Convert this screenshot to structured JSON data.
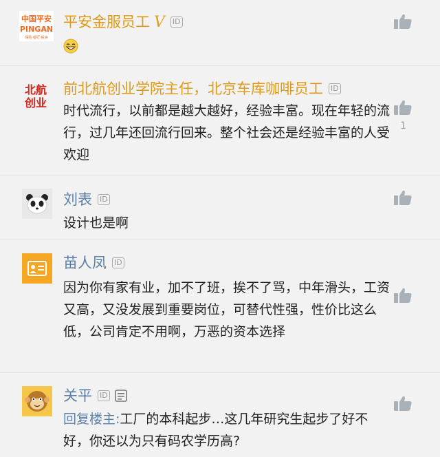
{
  "comments": [
    {
      "name": "平安金服员工",
      "name_color": "#e09a18",
      "verified": "V",
      "id_badge": "ID",
      "text": "",
      "has_emoji": true,
      "avatar": {
        "brand_cn": "中国平安",
        "brand_en": "PINGAN",
        "tagline": "保险·银行·投资"
      },
      "likes": ""
    },
    {
      "name": "前北航创业学院主任，北京车库咖啡员工",
      "name_color": "#e09a18",
      "id_badge": "ID",
      "text": "时代流行，以前都是越大越好，经验丰富。现在年轻的流行，过几年还回流行回来。整个社会还是经验丰富的人受欢迎",
      "avatar": {
        "line1": "北航",
        "line2": "创业"
      },
      "likes": "1"
    },
    {
      "name": "刘表",
      "name_color": "#5a7fa8",
      "id_badge": "ID",
      "text": "设计也是啊",
      "avatar": "panda-avatar",
      "likes": ""
    },
    {
      "name": "苗人凤",
      "name_color": "#5a7fa8",
      "id_badge": "ID",
      "text": "因为你有家有业，加不了班，挨不了骂，中年滑头，工资又高，又没发展到重要岗位，可替代性强，性价比这么低，公司肯定不用啊，万恶的资本选择",
      "avatar": "id-card-avatar",
      "likes": ""
    },
    {
      "name": "关平",
      "name_color": "#5a7fa8",
      "id_badge": "ID",
      "reply_prefix": "回复楼主:",
      "text": "工厂的本科起步…这几年研究生起步了好不好，你还以为只有码农学历高?",
      "avatar": "monkey-avatar",
      "likes": ""
    }
  ],
  "colors": {
    "accent_gold": "#e09a18",
    "link_blue": "#5a7fa8",
    "pingan_orange": "#f26a21",
    "beihang_red": "#d2281e",
    "icon_gray": "#a8b0b8"
  }
}
